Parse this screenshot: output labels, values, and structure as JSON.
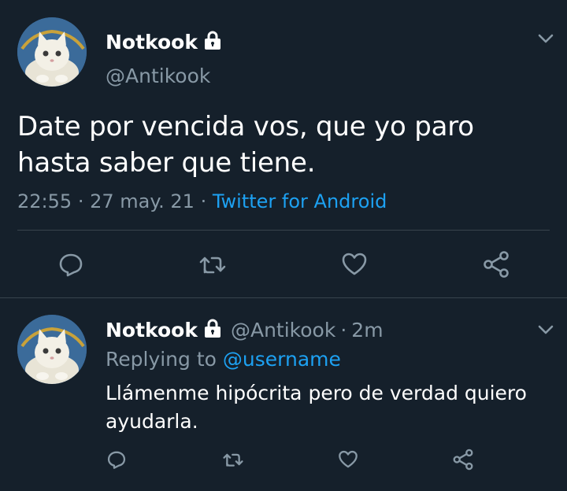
{
  "main_tweet": {
    "display_name": "Notkook",
    "handle": "@Antikook",
    "text_line1": "Date por vencida vos, que yo paro",
    "text_line2": "hasta saber que tiene.",
    "time": "22:55",
    "date": "27 may. 21",
    "separator": "·",
    "source": "Twitter for Android"
  },
  "reply_tweet": {
    "display_name": "Notkook",
    "handle": "@Antikook",
    "separator": "·",
    "age": "2m",
    "replying_prefix": "Replying to",
    "replying_to": "@username",
    "text_line1": "Llámenme hipócrita pero de verdad quiero",
    "text_line2": "ayudarla."
  },
  "colors": {
    "background": "#15202b",
    "text": "#ffffff",
    "secondary": "#8899a6",
    "accent": "#1da1f2",
    "divider": "#38444d"
  },
  "icons": [
    "lock-icon",
    "chevron-down-icon",
    "reply-icon",
    "retweet-icon",
    "like-icon",
    "share-icon"
  ]
}
